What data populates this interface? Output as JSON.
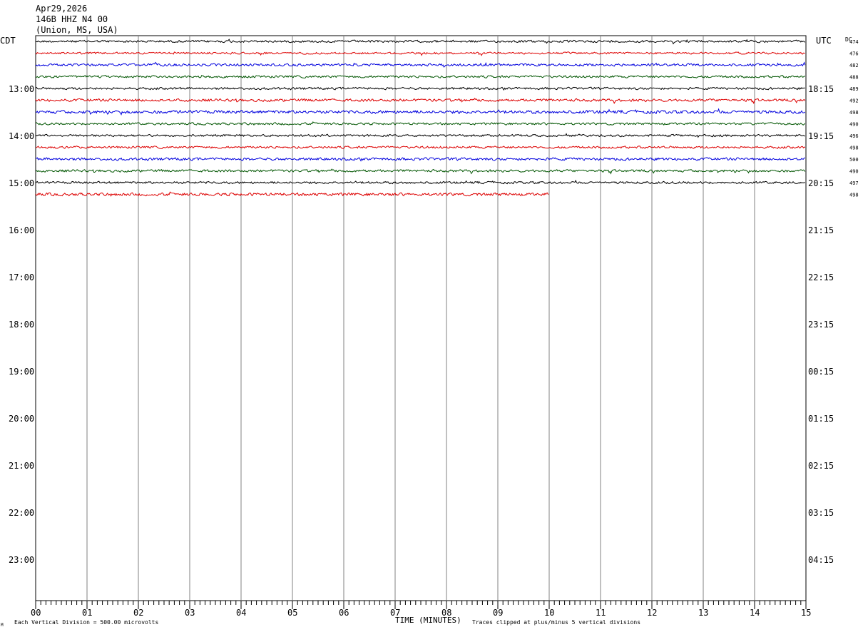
{
  "header": {
    "date": "Apr29,2026",
    "station": "146B HHZ N4 00",
    "location": "(Union, MS, USA)"
  },
  "tz_left": "CDT",
  "tz_right": "UTC",
  "dc_label": "DC",
  "left_hour_labels": [
    "13:00",
    "14:00",
    "15:00",
    "16:00",
    "17:00",
    "18:00",
    "19:00",
    "20:00",
    "21:00",
    "22:00",
    "23:00"
  ],
  "right_hour_labels": [
    "18:15",
    "19:15",
    "20:15",
    "21:15",
    "22:15",
    "23:15",
    "00:15",
    "01:15",
    "02:15",
    "03:15",
    "04:15"
  ],
  "x_tick_labels": [
    "00",
    "01",
    "02",
    "03",
    "04",
    "05",
    "06",
    "07",
    "08",
    "09",
    "10",
    "11",
    "12",
    "13",
    "14",
    "15"
  ],
  "footer": {
    "division_note": "Each Vertical Division =  500.00 microvolts",
    "time_label": "TIME (MINUTES)",
    "clip_note": "Traces clipped at plus/minus 5 vertical divisions",
    "corner_mark": "M"
  },
  "colors": {
    "trace_cycle": [
      "#000000",
      "#dd0000",
      "#0000dd",
      "#005500"
    ],
    "grid": "#808080"
  },
  "chart_data": {
    "type": "line",
    "xlabel": "TIME (MINUTES)",
    "xlim": [
      0,
      15
    ],
    "x_grid_minutes": 1,
    "traces": [
      {
        "dc": "474",
        "duration_min": 15,
        "noise": 1.0
      },
      {
        "dc": "476",
        "duration_min": 15,
        "noise": 0.9
      },
      {
        "dc": "482",
        "duration_min": 15,
        "noise": 1.1
      },
      {
        "dc": "488",
        "duration_min": 15,
        "noise": 1.0
      },
      {
        "dc": "489",
        "duration_min": 15,
        "noise": 1.0
      },
      {
        "dc": "492",
        "duration_min": 15,
        "noise": 1.2
      },
      {
        "dc": "498",
        "duration_min": 15,
        "noise": 1.4
      },
      {
        "dc": "490",
        "duration_min": 15,
        "noise": 1.0
      },
      {
        "dc": "496",
        "duration_min": 15,
        "noise": 1.0
      },
      {
        "dc": "498",
        "duration_min": 15,
        "noise": 1.0
      },
      {
        "dc": "500",
        "duration_min": 15,
        "noise": 1.2
      },
      {
        "dc": "490",
        "duration_min": 15,
        "noise": 1.1
      },
      {
        "dc": "497",
        "duration_min": 15,
        "noise": 1.0
      },
      {
        "dc": "498",
        "duration_min": 10,
        "noise": 1.3
      }
    ]
  }
}
